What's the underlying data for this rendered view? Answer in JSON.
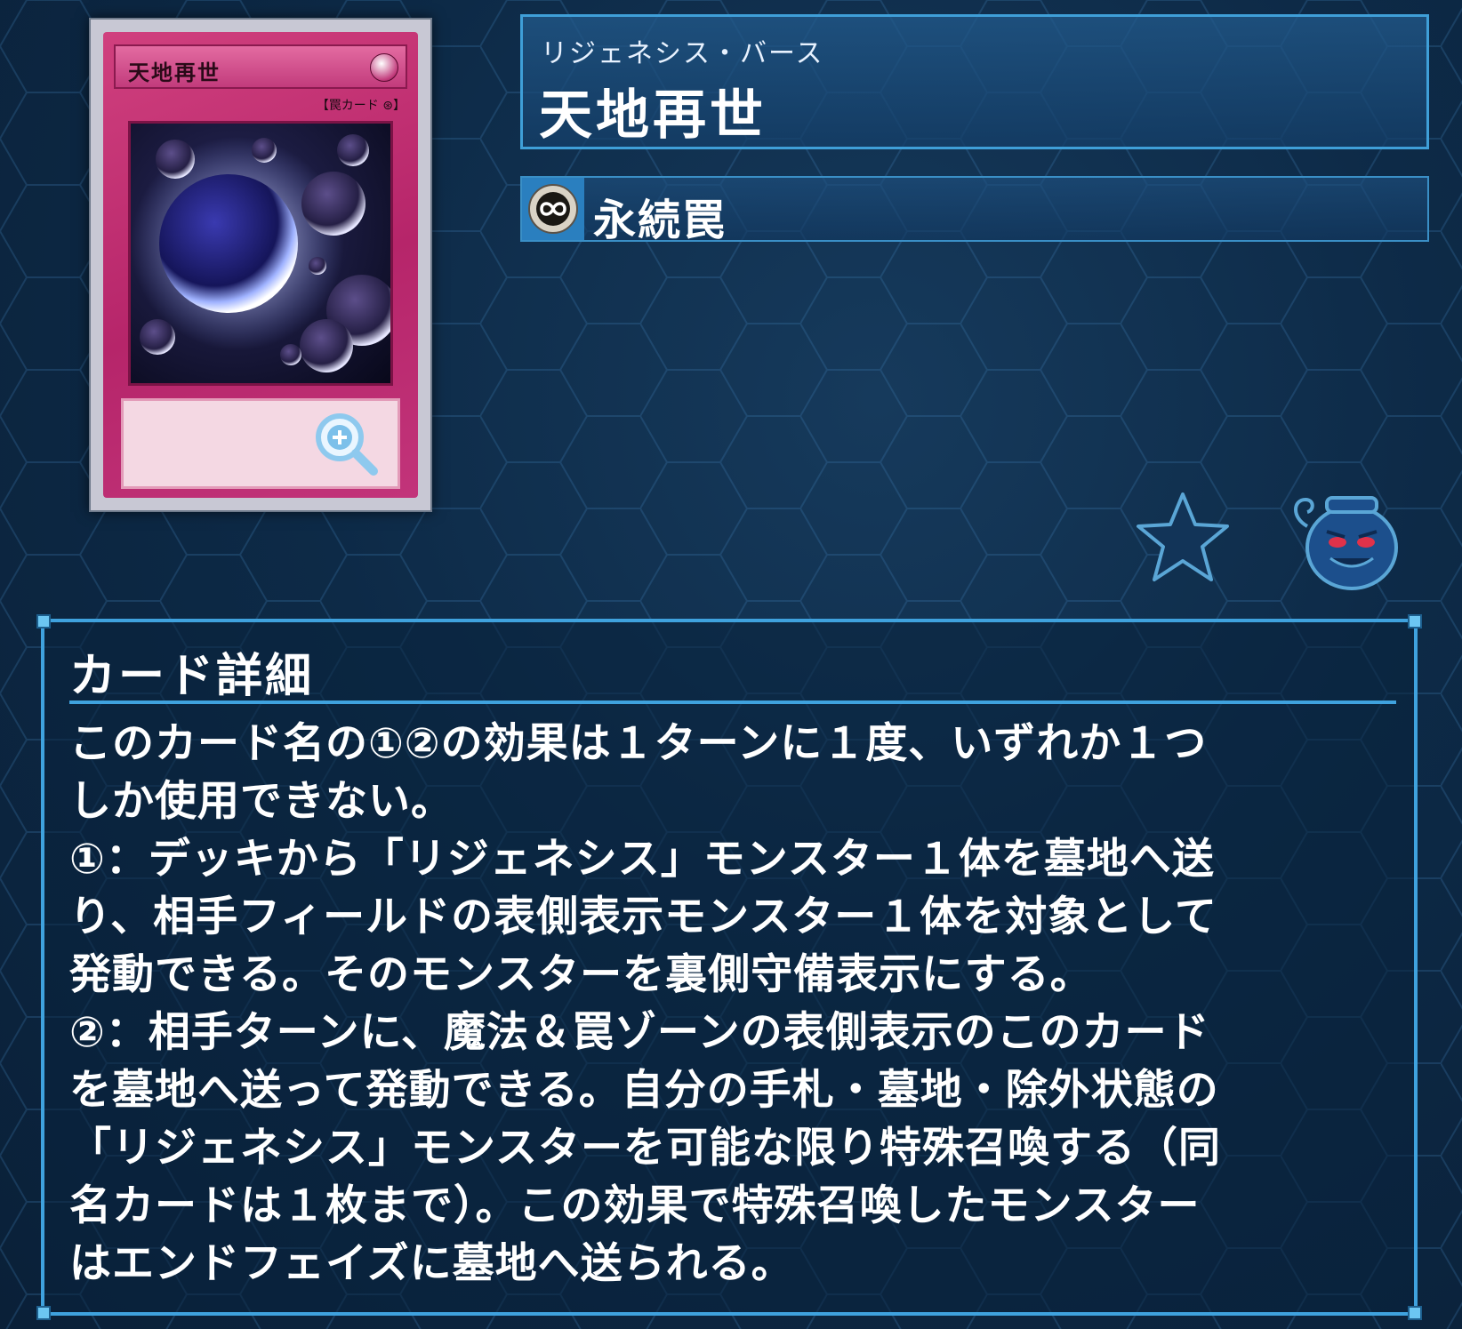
{
  "card": {
    "name_on_card": "天地再世",
    "type_line_on_card": "【罠カード ⊛】"
  },
  "header": {
    "ruby": "リジェネシス・バース",
    "name": "天地再世",
    "type_label": "永続罠"
  },
  "icons": {
    "zoom": "zoom-in-icon",
    "type": "continuous-icon",
    "favorite": "star-icon",
    "pot": "pot-of-greed-icon"
  },
  "colors": {
    "accent": "#3fa2de",
    "card_frame": "#c2347a",
    "background": "#0d2a47"
  },
  "detail": {
    "title": "カード詳細",
    "lines": [
      "このカード名の①②の効果は１ターンに１度、いずれか１つ",
      "しか使用できない。",
      "①：デッキから「リジェネシス」モンスター１体を墓地へ送",
      "り、相手フィールドの表側表示モンスター１体を対象として",
      "発動できる。そのモンスターを裏側守備表示にする。",
      "②：相手ターンに、魔法＆罠ゾーンの表側表示のこのカード",
      "を墓地へ送って発動できる。自分の手札・墓地・除外状態の",
      "「リジェネシス」モンスターを可能な限り特殊召喚する（同",
      "名カードは１枚まで）。この効果で特殊召喚したモンスター",
      "はエンドフェイズに墓地へ送られる。"
    ]
  }
}
